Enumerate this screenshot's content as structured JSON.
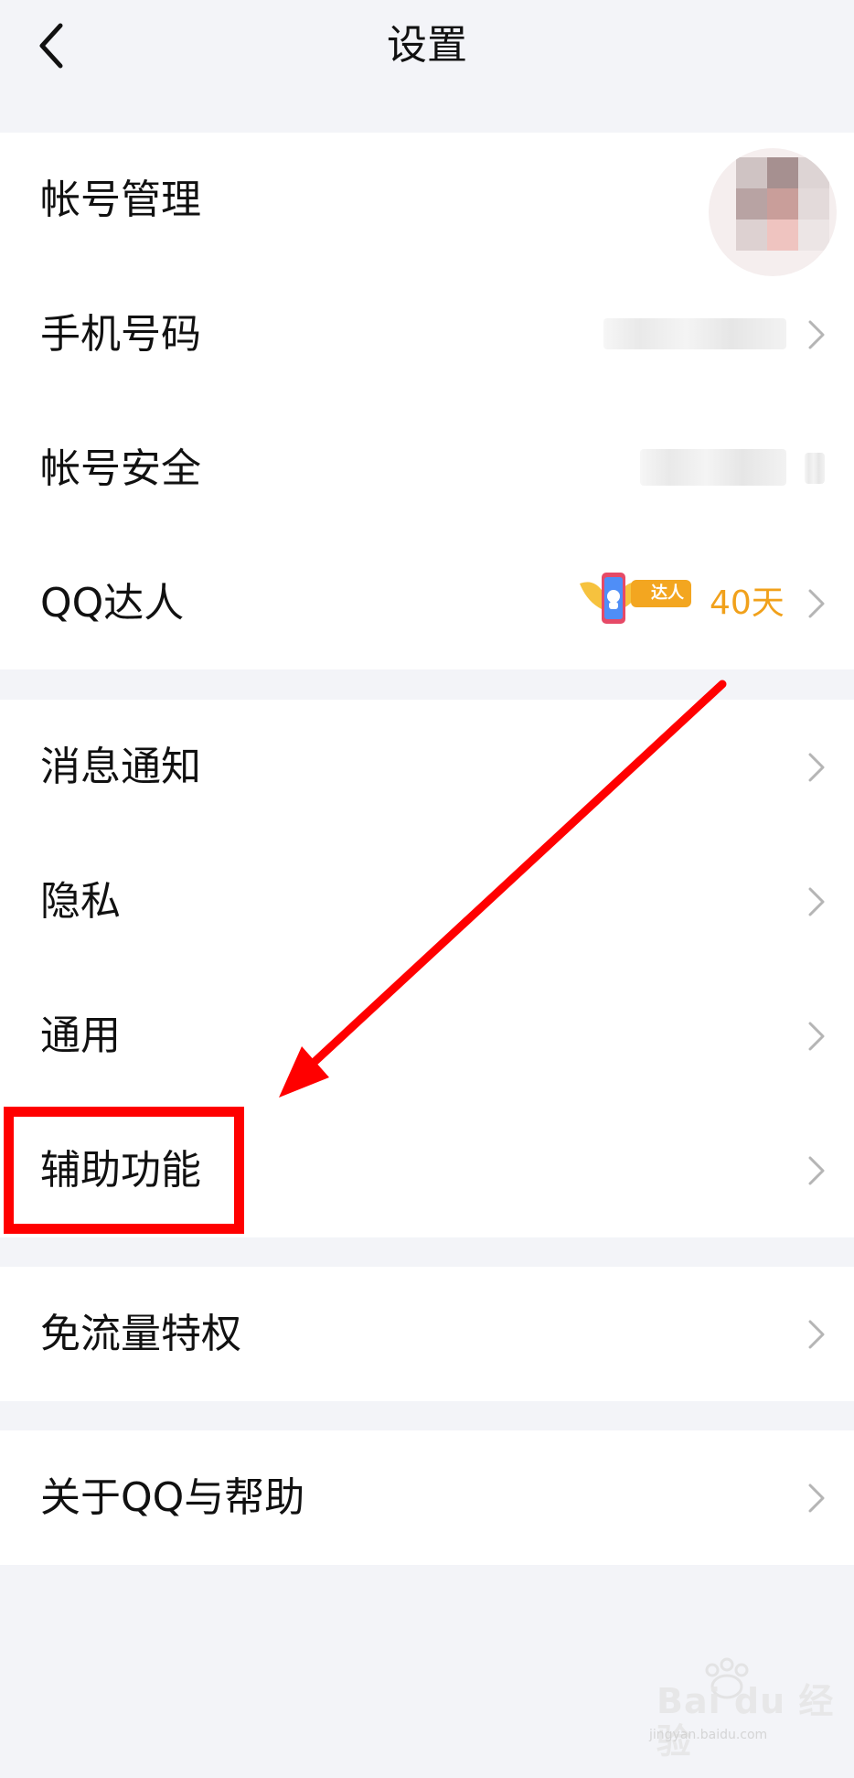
{
  "header": {
    "title": "设置",
    "back_icon": "chevron-left-icon"
  },
  "groups": {
    "account": [
      {
        "label": "帐号管理"
      },
      {
        "label": "手机号码"
      },
      {
        "label": "帐号安全"
      },
      {
        "label": "QQ达人",
        "badge_text": "达人",
        "days": "40天"
      }
    ],
    "main": [
      {
        "label": "消息通知"
      },
      {
        "label": "隐私"
      },
      {
        "label": "通用"
      },
      {
        "label": "辅助功能"
      }
    ],
    "data": [
      {
        "label": "免流量特权"
      }
    ],
    "about": [
      {
        "label": "关于QQ与帮助"
      }
    ]
  },
  "colors": {
    "accent_days": "#f1a11b",
    "annotation_red": "#ff0000",
    "background": "#f3f4f8"
  },
  "watermark": {
    "text": "Bai du 经验",
    "sub": "jingyan.baidu.com"
  }
}
